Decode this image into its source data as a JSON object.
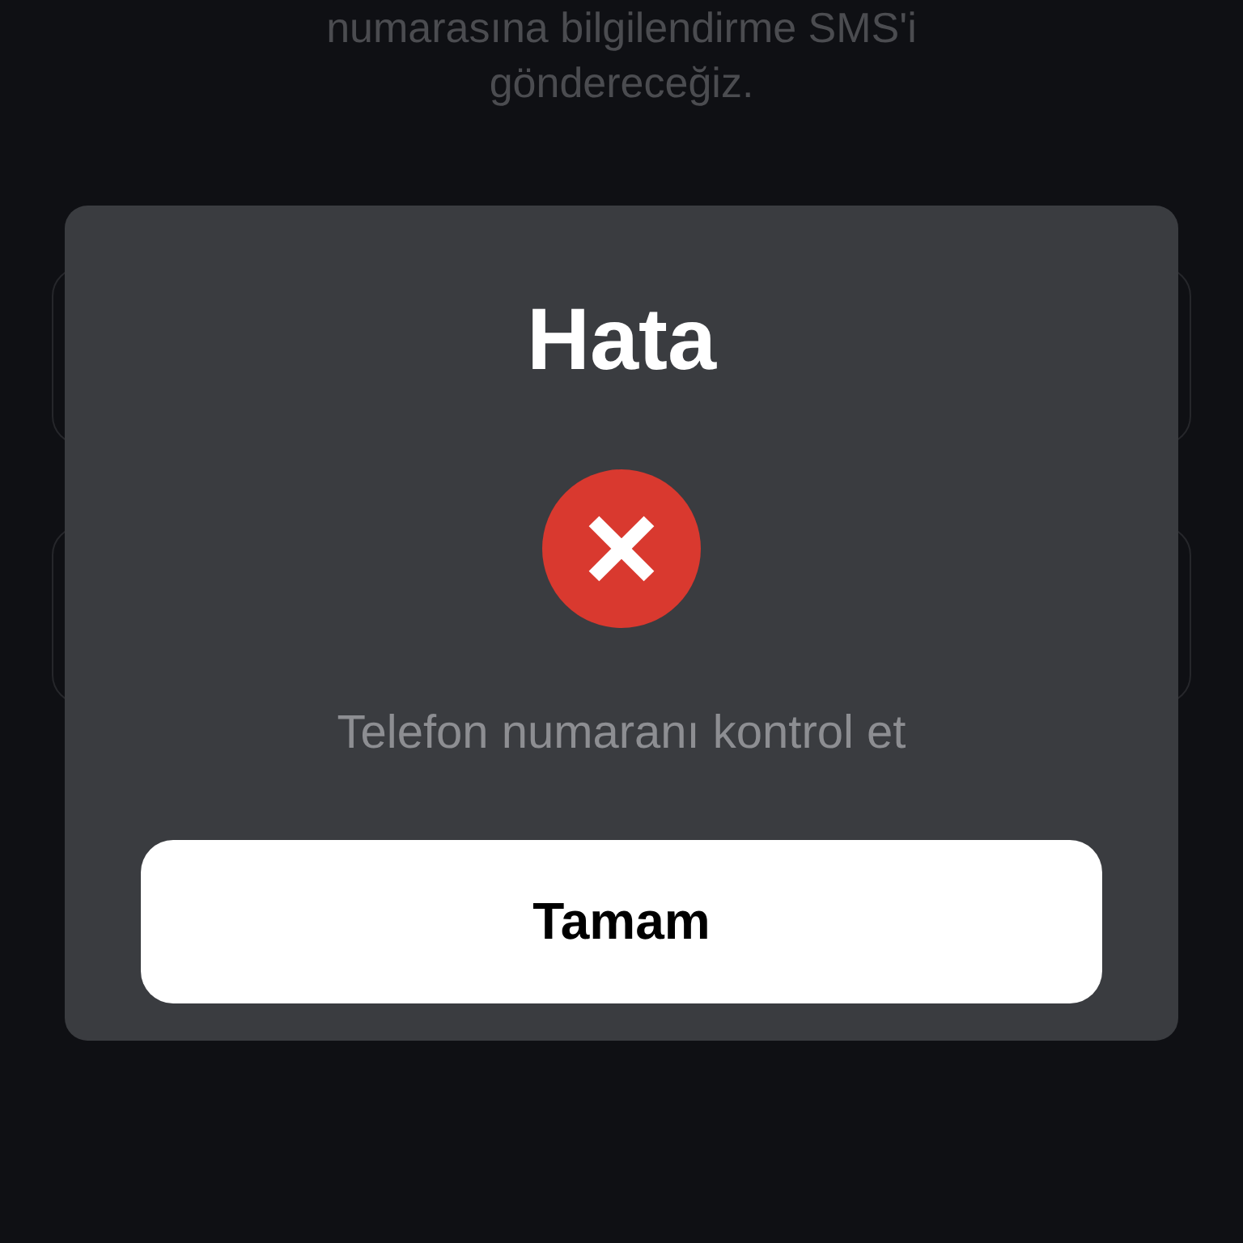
{
  "background": {
    "info_text": "numarasına bilgilendirme SMS'i göndereceğiz.",
    "input_fields": [
      {
        "kind": "text"
      },
      {
        "kind": "text"
      }
    ]
  },
  "dialog": {
    "kind": "error",
    "title": "Hata",
    "message": "Telefon numaranı kontrol et",
    "button": "Tamam"
  }
}
